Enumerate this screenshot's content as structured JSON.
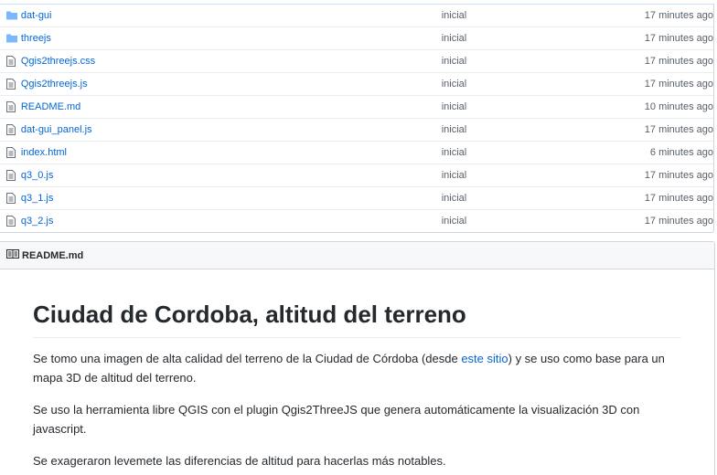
{
  "files": [
    {
      "name": "dat-gui",
      "type": "folder",
      "message": "inicial",
      "age": "17 minutes ago"
    },
    {
      "name": "threejs",
      "type": "folder",
      "message": "inicial",
      "age": "17 minutes ago"
    },
    {
      "name": "Qgis2threejs.css",
      "type": "file",
      "message": "inicial",
      "age": "17 minutes ago"
    },
    {
      "name": "Qgis2threejs.js",
      "type": "file",
      "message": "inicial",
      "age": "17 minutes ago"
    },
    {
      "name": "README.md",
      "type": "file",
      "message": "inicial",
      "age": "10 minutes ago"
    },
    {
      "name": "dat-gui_panel.js",
      "type": "file",
      "message": "inicial",
      "age": "17 minutes ago"
    },
    {
      "name": "index.html",
      "type": "file",
      "message": "inicial",
      "age": "6 minutes ago"
    },
    {
      "name": "q3_0.js",
      "type": "file",
      "message": "inicial",
      "age": "17 minutes ago"
    },
    {
      "name": "q3_1.js",
      "type": "file",
      "message": "inicial",
      "age": "17 minutes ago"
    },
    {
      "name": "q3_2.js",
      "type": "file",
      "message": "inicial",
      "age": "17 minutes ago"
    }
  ],
  "readme": {
    "header": "README.md",
    "title": "Ciudad de Cordoba, altitud del terreno",
    "p1_before": "Se tomo una imagen de alta calidad del terreno de la Ciudad de Córdoba (desde ",
    "p1_link": "este sitio",
    "p1_after": ") y se uso como base para un mapa 3D de altitud del terreno.",
    "p2": "Se uso la herramienta libre QGIS con el plugin Qgis2ThreeJS que genera automáticamente la visualización 3D con javascript.",
    "p3": "Se exageraron levemete las diferencias de altitud para hacerlas más notables."
  },
  "colors": {
    "link": "#0366d6",
    "folder": "#79b8ff",
    "file_icon": "#6a737d"
  }
}
